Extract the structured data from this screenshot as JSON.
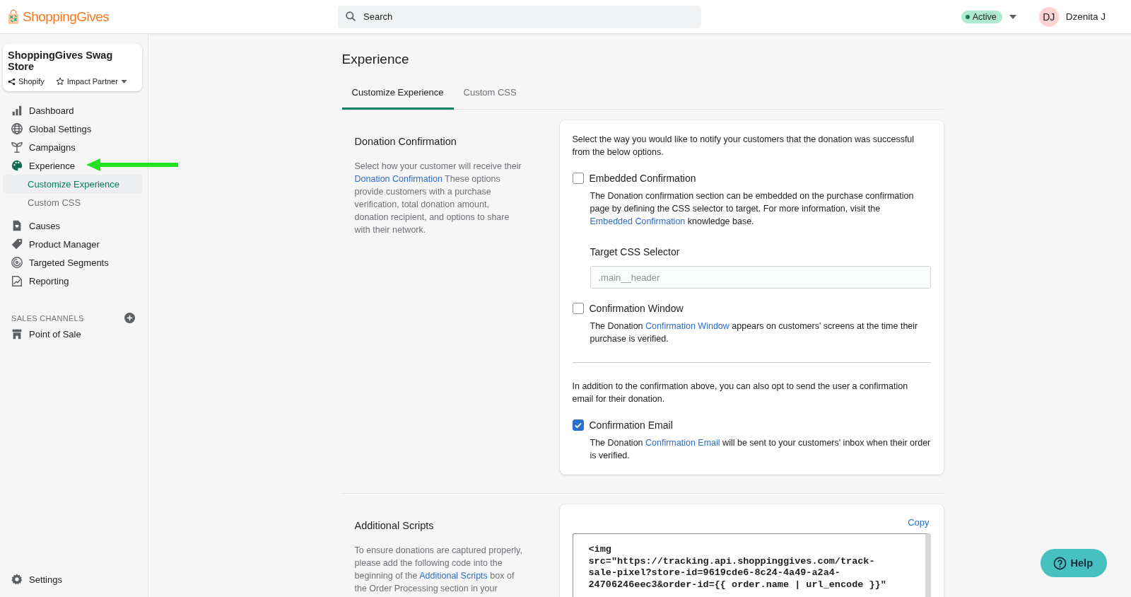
{
  "header": {
    "logo": "ShoppingGives",
    "search": {
      "placeholder": "Search"
    },
    "status": {
      "label": "Active",
      "color": "#1f7a4d"
    },
    "user": {
      "initials": "DJ",
      "name": "Dzenita J"
    }
  },
  "store": {
    "name": "ShoppingGives Swag Store",
    "platform": "Shopify",
    "plan": "Impact Partner"
  },
  "nav": [
    {
      "label": "Dashboard",
      "selected": false
    },
    {
      "label": "Global Settings",
      "selected": false
    },
    {
      "label": "Campaigns",
      "selected": false
    },
    {
      "label": "Experience",
      "selected": true,
      "children": [
        {
          "label": "Customize Experience",
          "selected": true
        },
        {
          "label": "Custom CSS",
          "selected": false
        }
      ]
    },
    {
      "label": "Causes",
      "selected": false
    },
    {
      "label": "Product Manager",
      "selected": false
    },
    {
      "label": "Targeted Segments",
      "selected": false
    },
    {
      "label": "Reporting",
      "selected": false
    }
  ],
  "sales_channels": {
    "heading": "SALES CHANNELS",
    "items": [
      {
        "label": "Point of Sale"
      }
    ]
  },
  "settings": {
    "label": "Settings"
  },
  "page": {
    "title": "Experience",
    "tabs": [
      {
        "label": "Customize Experience",
        "selected": true
      },
      {
        "label": "Custom CSS",
        "selected": false
      }
    ],
    "donation": {
      "title": "Donation Confirmation",
      "description": [
        {
          "kind": "text",
          "text": "Select how your customer will receive their "
        },
        {
          "kind": "link",
          "text": "Donation Confirmation"
        },
        {
          "kind": "text",
          "text": " These options provide customers with a purchase verification, total donation amount, donation recipient, and options to share with their network."
        }
      ],
      "intro": "Select the way you would like to notify your customers that the donation was successful from the below options.",
      "options": [
        {
          "label": "Embedded Confirmation",
          "checked": false,
          "description": [
            {
              "kind": "text",
              "text": "The Donation confirmation section can be embedded on the purchase confirmation page by defining the CSS selector to target. For more information, visit the "
            },
            {
              "kind": "link",
              "text": "Embedded Confirmation"
            },
            {
              "kind": "text",
              "text": " knowledge base."
            }
          ],
          "field": {
            "label": "Target CSS Selector",
            "placeholder": ".main__header"
          }
        },
        {
          "label": "Confirmation Window",
          "checked": false,
          "description": [
            {
              "kind": "text",
              "text": "The Donation "
            },
            {
              "kind": "link",
              "text": "Confirmation Window"
            },
            {
              "kind": "text",
              "text": " appears on customers' screens at the time their purchase is verified."
            }
          ]
        }
      ],
      "email_intro": "In addition to the confirmation above, you can also opt to send the user a confirmation email for their donation.",
      "email_option": {
        "label": "Confirmation Email",
        "checked": true,
        "description": [
          {
            "kind": "text",
            "text": "The Donation "
          },
          {
            "kind": "link",
            "text": "Confirmation Email"
          },
          {
            "kind": "text",
            "text": " will be sent to your customers' inbox when their order is verified."
          }
        ]
      }
    },
    "scripts": {
      "title": "Additional Scripts",
      "description": [
        {
          "kind": "text",
          "text": "To ensure donations are captured properly, please add the following code into the beginning of the "
        },
        {
          "kind": "link",
          "text": "Additional Scripts"
        },
        {
          "kind": "text",
          "text": " box of the Order Processing section in your"
        }
      ],
      "copy": "Copy",
      "code": "<img src=\"https://tracking.api.shoppinggives.com/track-sale-pixel?store-id=9619cde6-8c24-4a49-a2a4-24706246eec3&order-id={{ order.name | url_encode }}\""
    }
  },
  "help": {
    "label": "Help"
  }
}
